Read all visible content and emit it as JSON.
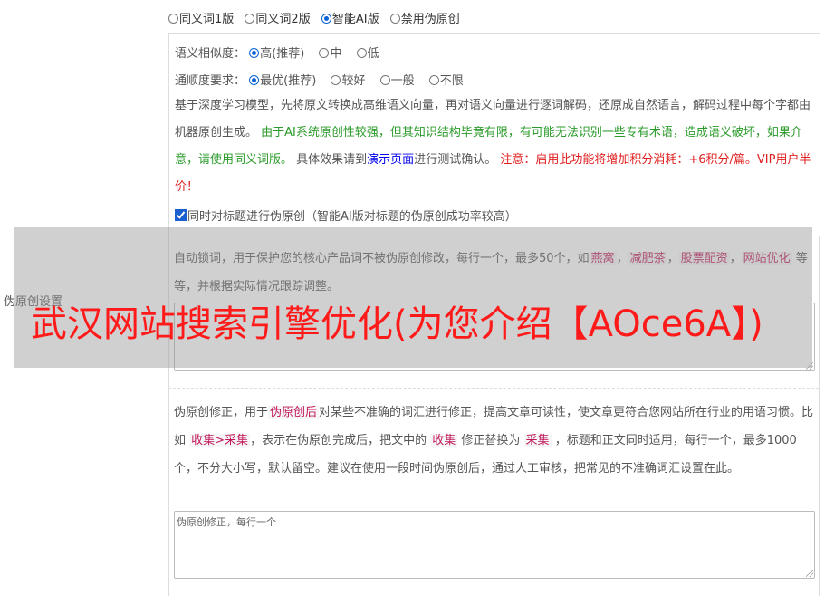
{
  "version_options": [
    {
      "label": "同义词1版",
      "checked": false
    },
    {
      "label": "同义词2版",
      "checked": false
    },
    {
      "label": "智能AI版",
      "checked": true
    },
    {
      "label": "禁用伪原创",
      "checked": false
    }
  ],
  "similarity": {
    "label": "语义相似度：",
    "options": [
      {
        "label": "高(推荐)",
        "checked": true
      },
      {
        "label": "中",
        "checked": false
      },
      {
        "label": "低",
        "checked": false
      }
    ]
  },
  "fluency": {
    "label": "通顺度要求：",
    "options": [
      {
        "label": "最优(推荐)",
        "checked": true
      },
      {
        "label": "较好",
        "checked": false
      },
      {
        "label": "一般",
        "checked": false
      },
      {
        "label": "不限",
        "checked": false
      }
    ]
  },
  "description": {
    "p1": "基于深度学习模型，先将原文转换成高维语义向量，再对语义向量进行逐词解码，还原成自然语言，解码过程中每个字都由机器原创生成。",
    "p2_green": "由于AI系统原创性较强，但其知识结构毕竟有限，有可能无法识别一些专有术语，造成语义破坏，如果介意，请使用同义词版。",
    "p3a": "具体效果请到",
    "p3_link": "演示页面",
    "p3b": "进行测试确认。",
    "p4_red": "注意：启用此功能将增加积分消耗：+6积分/篇。VIP用户半价！"
  },
  "title_checkbox": {
    "label": "同时对标题进行伪原创（智能AI版对标题的伪原创成功率较高）",
    "checked": true
  },
  "section_label": "伪原创设置",
  "lock_words": {
    "hint_a": "自动锁词，用于保护您的核心产品词不被伪原创修改，每行一个，最多50个，如",
    "tags": [
      "燕窝",
      "减肥茶",
      "股票配资",
      "网站优化"
    ],
    "hint_b": "等等，并根据实际情况跟踪调整。"
  },
  "overlay_banner": "武汉网站搜索引擎优化(为您介绍【AOce6A】)",
  "correction": {
    "text_a": "伪原创修正，用于",
    "tag1": "伪原创后",
    "text_b": "对某些不准确的词汇进行修正，提高文章可读性，使文章更符合您网站所在行业的用语习惯。比如",
    "tag2": "收集>采集",
    "text_c": "，表示在伪原创完成后，把文中的",
    "tag3": "收集",
    "text_d": "修正替换为",
    "tag4": "采集",
    "text_e": "，标题和正文同时适用，每行一个，最多1000个，不分大小写，默认留空。建议在使用一段时间伪原创后，通过人工审核，把常见的不准确词汇设置在此。",
    "placeholder": "伪原创修正，每行一个"
  }
}
